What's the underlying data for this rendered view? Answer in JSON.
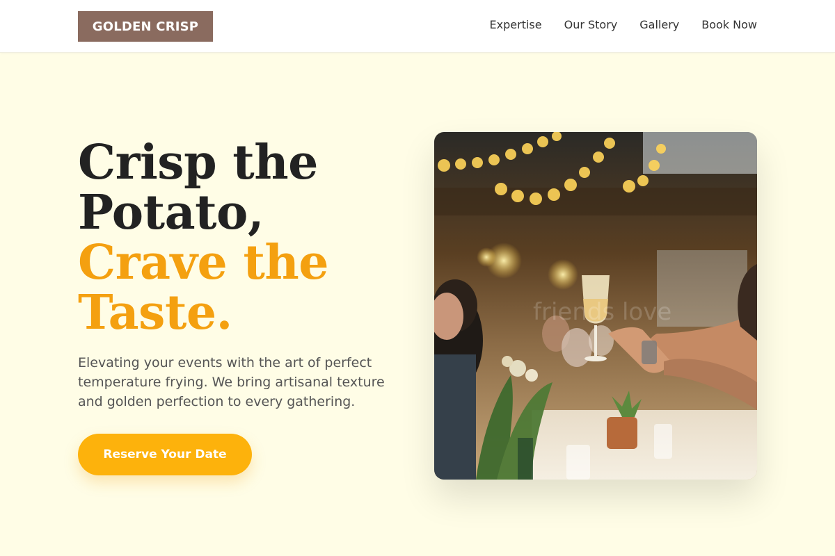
{
  "header": {
    "logo": "GOLDEN CRISP",
    "nav": [
      {
        "label": "Expertise"
      },
      {
        "label": "Our Story"
      },
      {
        "label": "Gallery"
      },
      {
        "label": "Book Now"
      }
    ]
  },
  "hero": {
    "title_line1": "Crisp the",
    "title_line2": "Potato,",
    "title_line3": "Crave the",
    "title_line4": "Taste.",
    "description": "Elevating your events with the art of perfect temperature frying. We bring artisanal texture and golden perfection to every gathering.",
    "cta_label": "Reserve Your Date",
    "image_watermark": "friends love"
  },
  "colors": {
    "background": "#fffde6",
    "accent": "#f4a010",
    "button": "#fdb20c",
    "logo_bg": "#8a6b5f"
  }
}
